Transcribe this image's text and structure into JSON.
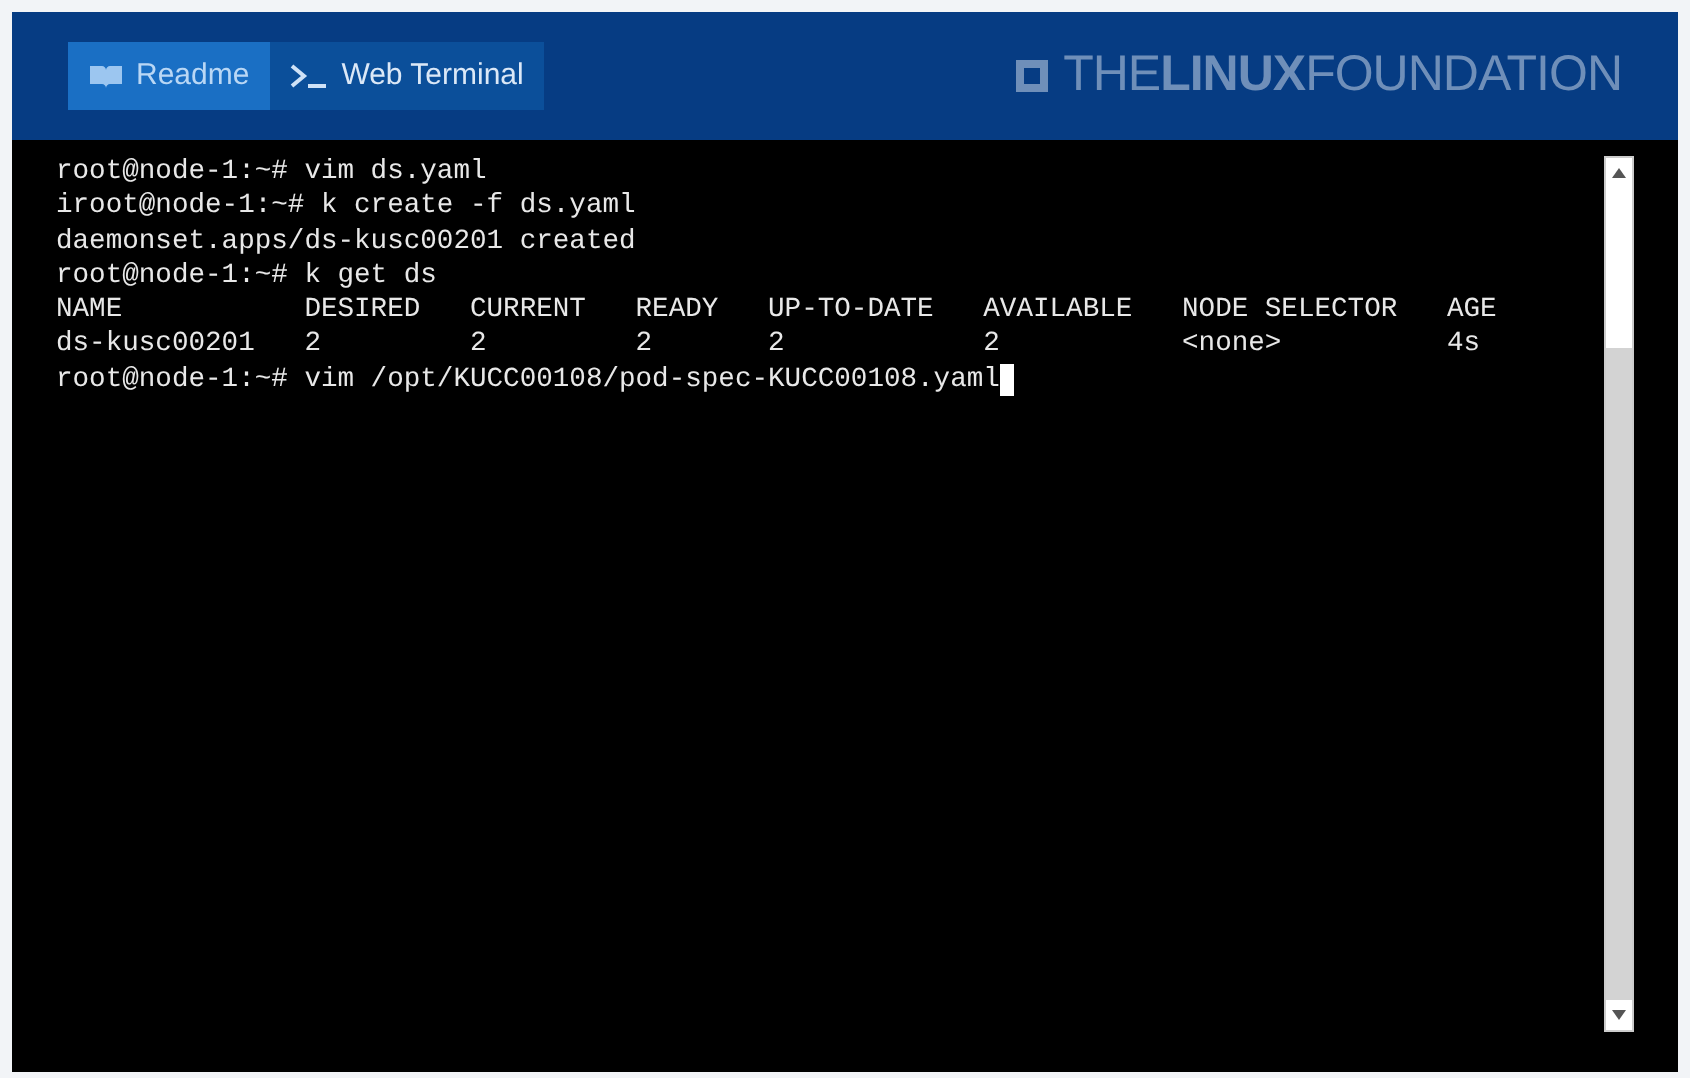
{
  "tabs": [
    {
      "label": "Readme",
      "selected": true
    },
    {
      "label": "Web Terminal",
      "selected": false
    }
  ],
  "logo": "THE**LINUX**FOUNDATION",
  "terminal": {
    "lines": [
      "root@node-1:~# vim ds.yaml",
      "iroot@node-1:~# k create -f ds.yaml",
      "daemonset.apps/ds-kusc00201 created",
      "root@node-1:~# k get ds",
      "NAME           DESIRED   CURRENT   READY   UP-TO-DATE   AVAILABLE   NODE SELECTOR   AGE",
      "ds-kusc00201   2         2         2       2            2           <none>          4s",
      "root@node-1:~# vim /opt/KUCC00108/pod-spec-KUCC00108.yaml"
    ],
    "cursor": true
  }
}
